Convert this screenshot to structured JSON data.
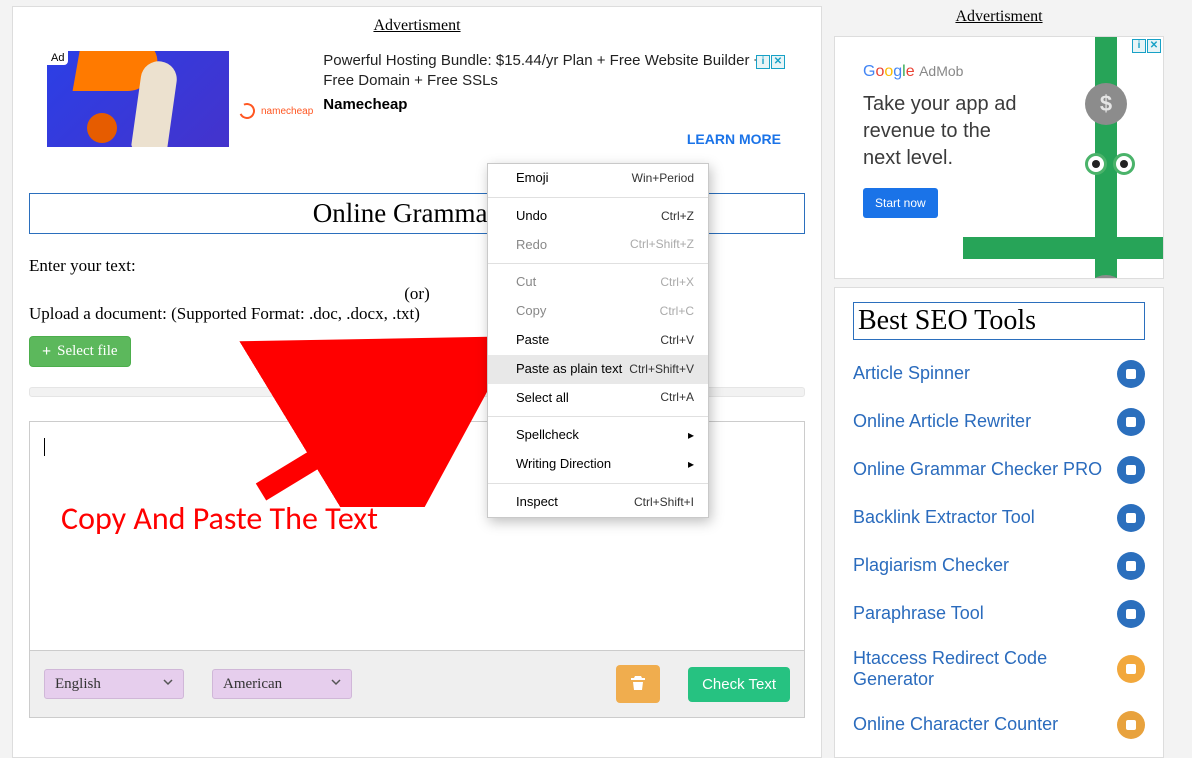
{
  "main": {
    "ad_label": "Advertisment",
    "top_ad": {
      "tag": "Ad",
      "brand": "namecheap",
      "line1": "Powerful Hosting Bundle: $15.44/yr Plan + Free Website Builder + Free Domain + Free SSLs",
      "advertiser": "Namecheap",
      "cta": "LEARN MORE"
    },
    "page_title": "Online Grammar C",
    "enter_text_label": "Enter your text:",
    "or_label": "(or)",
    "upload_label": "Upload a document: (Supported Format: .doc, .docx, .txt)",
    "select_file_label": "Select file",
    "editor": {
      "value": ""
    },
    "footer": {
      "lang_value": "English",
      "variant_value": "American"
    },
    "delete_label": "",
    "check_text_label": "Check Text",
    "annotation": "Copy And Paste The Text"
  },
  "context_menu": {
    "items": [
      {
        "label": "Emoji",
        "shortcut": "Win+Period",
        "disabled": false
      },
      {
        "sep": true
      },
      {
        "label": "Undo",
        "shortcut": "Ctrl+Z",
        "disabled": false
      },
      {
        "label": "Redo",
        "shortcut": "Ctrl+Shift+Z",
        "disabled": true
      },
      {
        "sep": true
      },
      {
        "label": "Cut",
        "shortcut": "Ctrl+X",
        "disabled": true
      },
      {
        "label": "Copy",
        "shortcut": "Ctrl+C",
        "disabled": true
      },
      {
        "label": "Paste",
        "shortcut": "Ctrl+V",
        "disabled": false
      },
      {
        "label": "Paste as plain text",
        "shortcut": "Ctrl+Shift+V",
        "disabled": false,
        "highlight": true
      },
      {
        "label": "Select all",
        "shortcut": "Ctrl+A",
        "disabled": false
      },
      {
        "sep": true
      },
      {
        "label": "Spellcheck",
        "submenu": true,
        "disabled": false
      },
      {
        "label": "Writing Direction",
        "submenu": true,
        "disabled": false
      },
      {
        "sep": true
      },
      {
        "label": "Inspect",
        "shortcut": "Ctrl+Shift+I",
        "disabled": false
      }
    ]
  },
  "sidebar": {
    "ad_label": "Advertisment",
    "admob": {
      "brand_parts": [
        "G",
        "o",
        "o",
        "g",
        "l",
        "e"
      ],
      "brand_suffix": "AdMob",
      "copy": "Take your app ad revenue to the next level.",
      "cta": "Start now"
    },
    "tools_title": "Best SEO Tools",
    "tools": [
      {
        "label": "Article Spinner"
      },
      {
        "label": "Online Article Rewriter"
      },
      {
        "label": "Online Grammar Checker PRO"
      },
      {
        "label": "Backlink Extractor Tool"
      },
      {
        "label": "Plagiarism Checker"
      },
      {
        "label": "Paraphrase Tool"
      },
      {
        "label": "Htaccess Redirect Code Generator"
      },
      {
        "label": "Online Character Counter"
      }
    ]
  }
}
